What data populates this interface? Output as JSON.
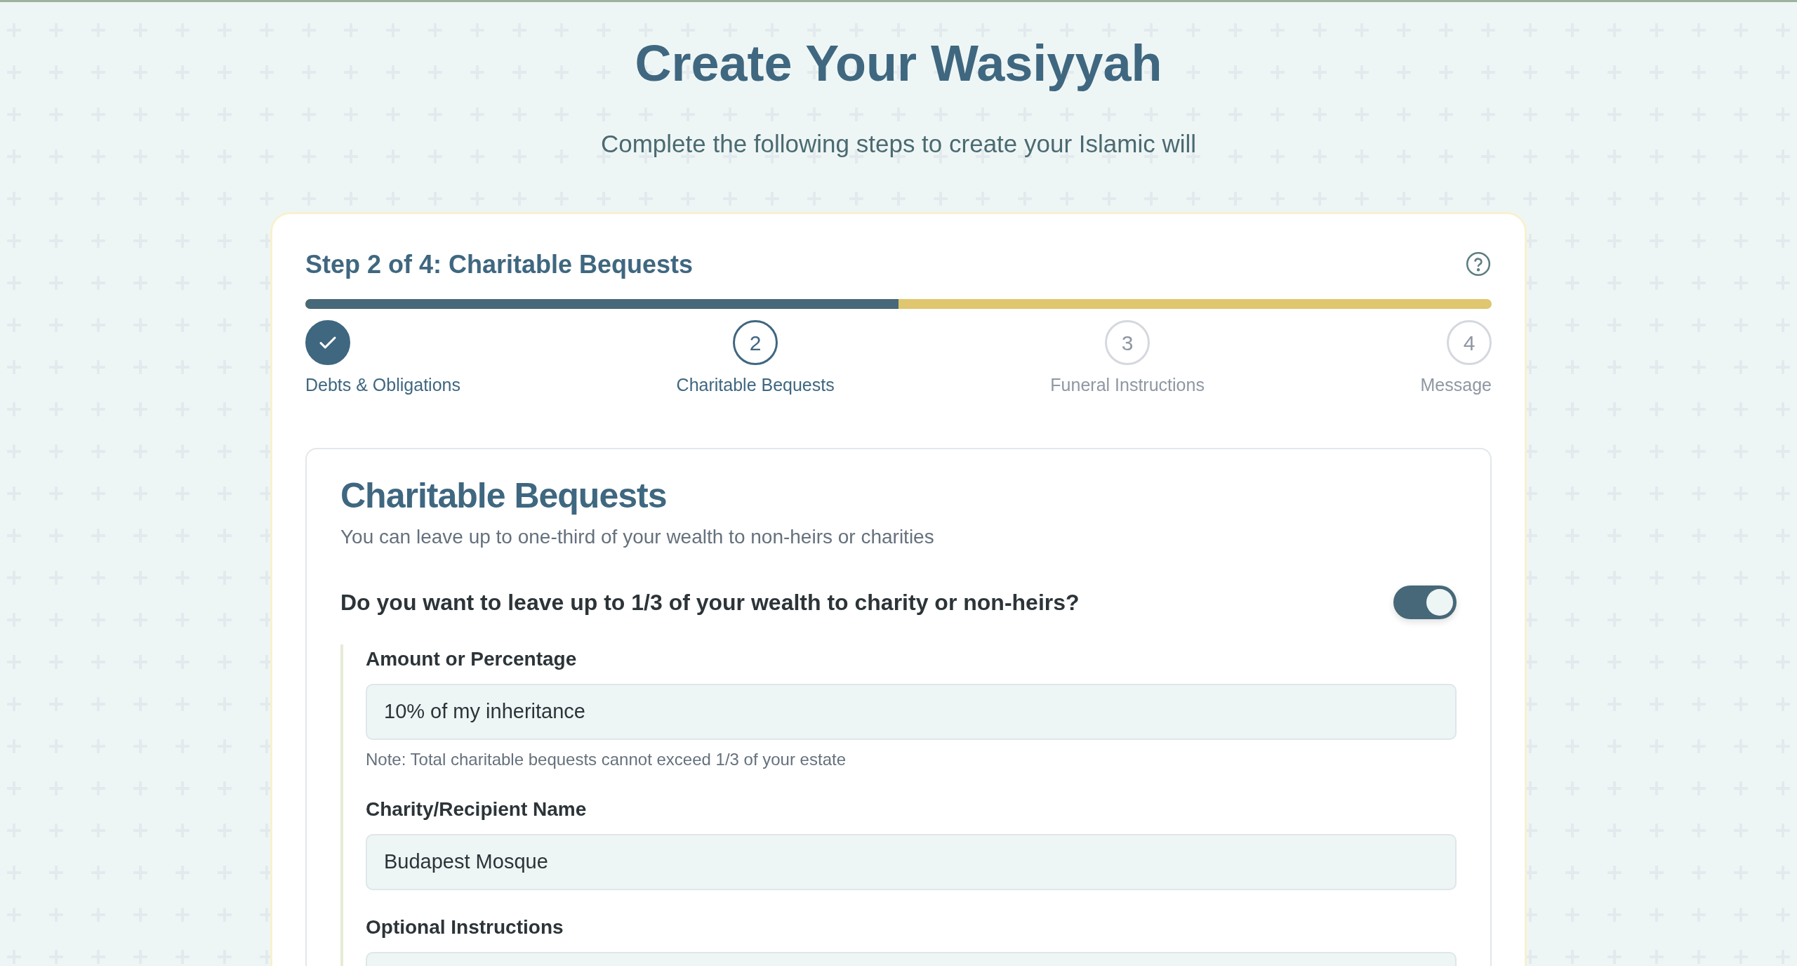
{
  "header": {
    "title": "Create Your Wasiyyah",
    "subtitle": "Complete the following steps to create your Islamic will"
  },
  "wizard": {
    "step_title": "Step 2 of 4: Charitable Bequests",
    "progress": {
      "level": 0.5
    },
    "steps": [
      {
        "label": "Debts & Obligations",
        "completed": true,
        "selected": false
      },
      {
        "number": "2",
        "label": "Charitable Bequests",
        "completed": false,
        "selected": true
      },
      {
        "number": "3",
        "label": "Funeral Instructions",
        "completed": false,
        "selected": false
      },
      {
        "number": "4",
        "label": "Message",
        "completed": false,
        "selected": false
      }
    ],
    "section": {
      "title": "Charitable Bequests",
      "description": "You can leave up to one-third of your wealth to non-heirs or charities",
      "question": {
        "text": "Do you want to leave up to 1/3 of your wealth to charity or non-heirs?",
        "on": true
      },
      "fields": [
        {
          "label": "Amount or Percentage",
          "value": "10% of my inheritance",
          "note": "Note: Total charitable bequests cannot exceed 1/3 of your estate"
        },
        {
          "label": "Charity/Recipient Name",
          "value": "Budapest Mosque"
        },
        {
          "label": "Optional Instructions"
        }
      ]
    }
  }
}
